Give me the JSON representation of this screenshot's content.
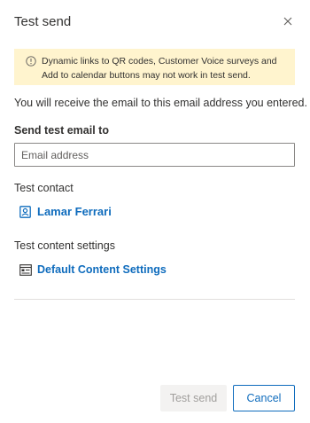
{
  "dialog": {
    "title": "Test send",
    "close_icon": "close-icon"
  },
  "warning": {
    "icon": "warning-icon",
    "text": "Dynamic links to QR codes, Customer Voice surveys and Add to calendar buttons may not work in test send."
  },
  "info_text": "You will receive the email to this email address you entered.",
  "email": {
    "label": "Send test email to",
    "placeholder": "Email address",
    "value": ""
  },
  "contact": {
    "label": "Test contact",
    "icon": "contact-card-icon",
    "name": "Lamar Ferrari"
  },
  "content_settings": {
    "label": "Test content settings",
    "icon": "content-settings-icon",
    "name": "Default Content Settings"
  },
  "buttons": {
    "test_send": "Test send",
    "cancel": "Cancel"
  },
  "colors": {
    "link": "#0f6cbd",
    "warning_bg": "#fff4ce",
    "disabled_bg": "#f3f2f1"
  }
}
